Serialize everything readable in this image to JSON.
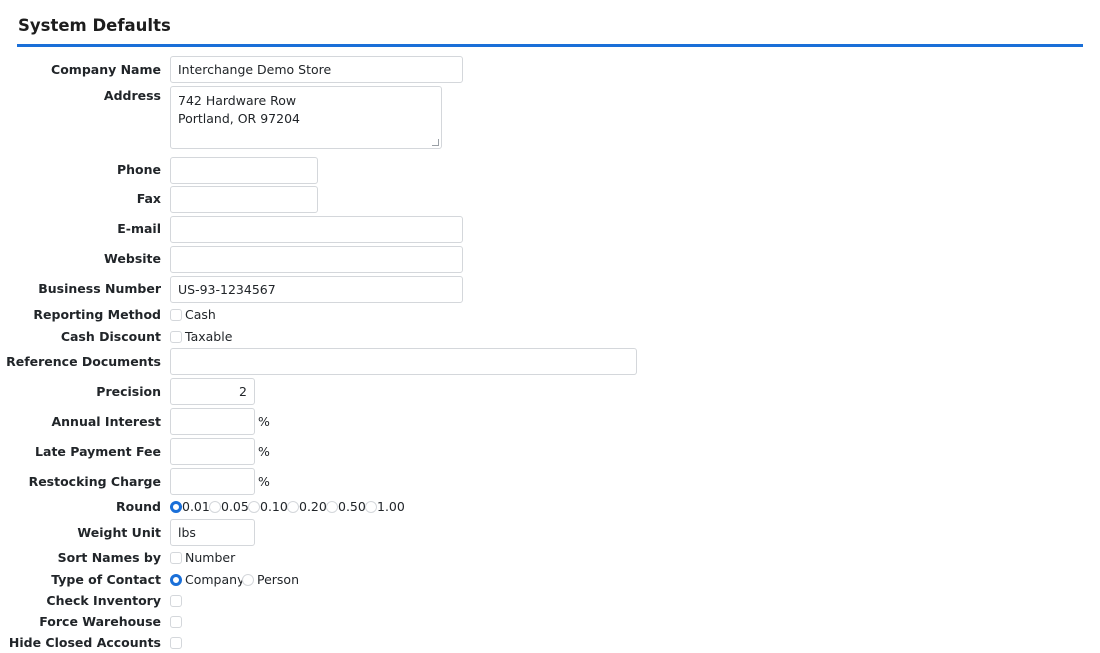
{
  "section_title": "System Defaults",
  "fields": {
    "company_name": {
      "label": "Company Name",
      "value": "Interchange Demo Store"
    },
    "address": {
      "label": "Address",
      "value": "742 Hardware Row\nPortland, OR 97204"
    },
    "phone": {
      "label": "Phone",
      "value": ""
    },
    "fax": {
      "label": "Fax",
      "value": ""
    },
    "email": {
      "label": "E-mail",
      "value": ""
    },
    "website": {
      "label": "Website",
      "value": ""
    },
    "business_number": {
      "label": "Business Number",
      "value": "US-93-1234567"
    },
    "reporting_method": {
      "label": "Reporting Method",
      "option": "Cash",
      "checked": false
    },
    "cash_discount": {
      "label": "Cash Discount",
      "option": "Taxable",
      "checked": false
    },
    "reference_documents": {
      "label": "Reference Documents",
      "value": ""
    },
    "precision": {
      "label": "Precision",
      "value": "2"
    },
    "annual_interest": {
      "label": "Annual Interest",
      "value": "",
      "unit": "%"
    },
    "late_payment_fee": {
      "label": "Late Payment Fee",
      "value": "",
      "unit": "%"
    },
    "restocking_charge": {
      "label": "Restocking Charge",
      "value": "",
      "unit": "%"
    },
    "round": {
      "label": "Round",
      "options": [
        "0.01",
        "0.05",
        "0.10",
        "0.20",
        "0.50",
        "1.00"
      ],
      "selected": "0.01"
    },
    "weight_unit": {
      "label": "Weight Unit",
      "value": "lbs"
    },
    "sort_names_by": {
      "label": "Sort Names by",
      "option": "Number",
      "checked": false
    },
    "type_of_contact": {
      "label": "Type of Contact",
      "options": [
        "Company",
        "Person"
      ],
      "selected": "Company"
    },
    "check_inventory": {
      "label": "Check Inventory",
      "checked": false
    },
    "force_warehouse": {
      "label": "Force Warehouse",
      "checked": false
    },
    "hide_closed_accounts": {
      "label": "Hide Closed Accounts",
      "checked": false
    }
  },
  "colors": {
    "accent": "#1a6fd8",
    "border": "#d4d7db"
  }
}
